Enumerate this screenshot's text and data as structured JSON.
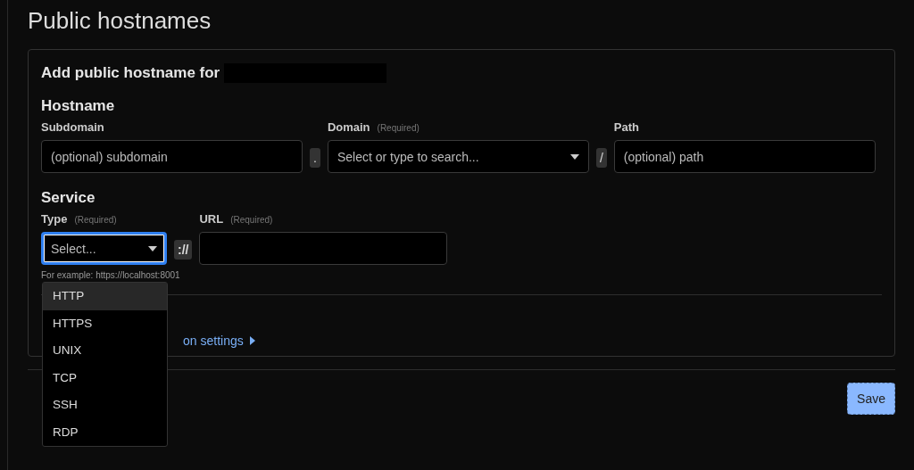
{
  "page_title": "Public hostnames",
  "card": {
    "heading": "Add public hostname for",
    "hostname": {
      "title": "Hostname",
      "subdomain": {
        "label": "Subdomain",
        "placeholder": "(optional) subdomain"
      },
      "dot": ".",
      "domain": {
        "label": "Domain",
        "required": "(Required)",
        "placeholder": "Select or type to search..."
      },
      "slash": "/",
      "path": {
        "label": "Path",
        "placeholder": "(optional) path"
      }
    },
    "service": {
      "title": "Service",
      "type": {
        "label": "Type",
        "required": "(Required)",
        "placeholder": "Select...",
        "expanded": true,
        "options": [
          {
            "label": "HTTP",
            "selected": true
          },
          {
            "label": "HTTPS",
            "selected": false
          },
          {
            "label": "UNIX",
            "selected": false
          },
          {
            "label": "TCP",
            "selected": false
          },
          {
            "label": "SSH",
            "selected": false
          },
          {
            "label": "RDP",
            "selected": false
          }
        ]
      },
      "separator": "://",
      "url": {
        "label": "URL",
        "required": "(Required)"
      },
      "hint": "For example: https://localhost:8001"
    },
    "settings_link": "on settings"
  },
  "save_button": "Save"
}
